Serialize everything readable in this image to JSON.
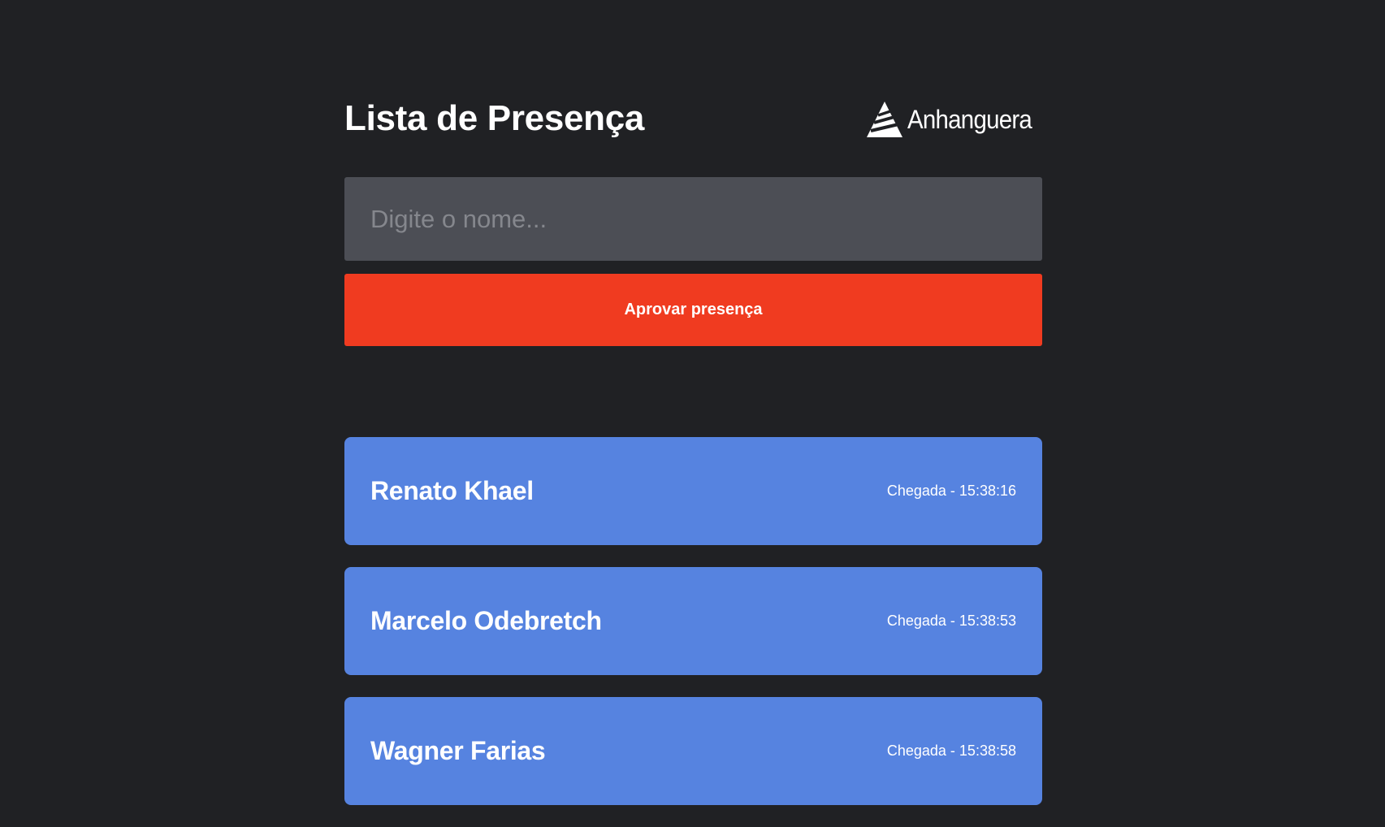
{
  "header": {
    "title": "Lista de Presença",
    "logo_text": "Anhanguera",
    "logo_icon": "anhanguera-triangle-logo"
  },
  "form": {
    "input_placeholder": "Digite o nome...",
    "input_value": "",
    "approve_label": "Aprovar presença"
  },
  "colors": {
    "background": "#202124",
    "input_background": "#4c4e55",
    "button_accent": "#f03b20",
    "card_background": "#5683e0",
    "text": "#ffffff"
  },
  "attendees": [
    {
      "name": "Renato Khael",
      "arrival": "Chegada - 15:38:16"
    },
    {
      "name": "Marcelo Odebretch",
      "arrival": "Chegada - 15:38:53"
    },
    {
      "name": "Wagner Farias",
      "arrival": "Chegada - 15:38:58"
    }
  ]
}
